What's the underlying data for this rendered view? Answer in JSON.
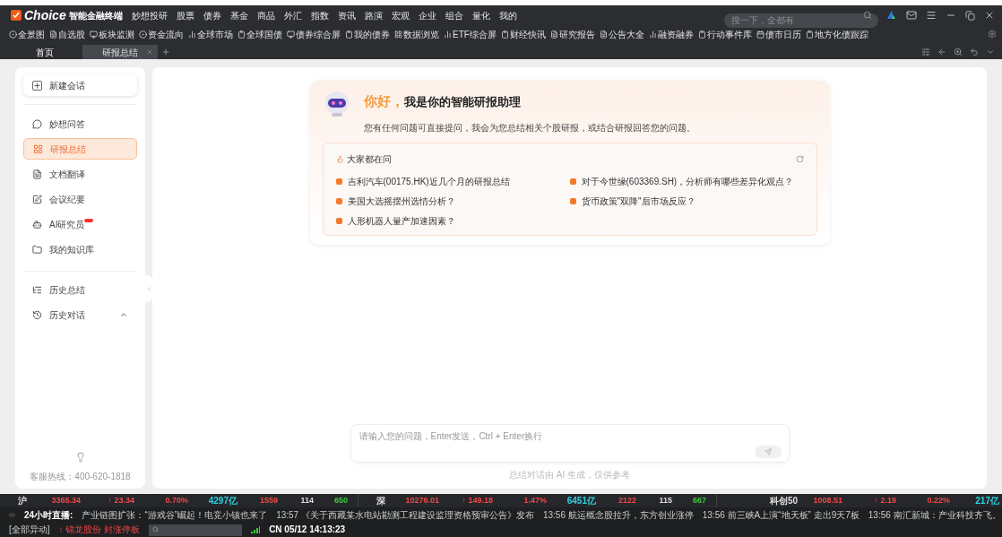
{
  "app": {
    "brand": "Choice",
    "brand_sub": "智能金融终端"
  },
  "menu": [
    "妙想投研",
    "股票",
    "债券",
    "基金",
    "商品",
    "外汇",
    "指数",
    "资讯",
    "路演",
    "宏观",
    "企业",
    "组合",
    "量化",
    "我的"
  ],
  "search": {
    "placeholder": "搜一下，全都有"
  },
  "toolbar": [
    "全景图",
    "自选股",
    "板块监测",
    "资金流向",
    "全球市场",
    "全球国债",
    "债券综合屏",
    "我的债券",
    "数据浏览",
    "ETF综合屏",
    "财经快讯",
    "研究报告",
    "公告大全",
    "融资融券",
    "行动事件库",
    "债市日历",
    "地方化债跟踪"
  ],
  "tabs": [
    {
      "label": "首页",
      "selected": false
    },
    {
      "label": "研报总结",
      "selected": true
    }
  ],
  "sidebar": {
    "new_chat": "新建会话",
    "items": [
      {
        "label": "妙想问答",
        "selected": false,
        "badge": false
      },
      {
        "label": "研报总结",
        "selected": true,
        "badge": false
      },
      {
        "label": "文档翻译",
        "selected": false,
        "badge": false
      },
      {
        "label": "会议纪要",
        "selected": false,
        "badge": false
      },
      {
        "label": "AI研究员",
        "selected": false,
        "badge": true
      },
      {
        "label": "我的知识库",
        "selected": false,
        "badge": false
      }
    ],
    "history": [
      {
        "label": "历史总结"
      },
      {
        "label": "历史对话",
        "expanded": true
      }
    ],
    "hotline": "客服热线：400-620-1818"
  },
  "assistant": {
    "greeting": "你好，",
    "title": "我是你的智能研报助理",
    "intro": "您有任何问题可直接提问，我会为您总结相关个股研报，或结合研报回答您的问题。",
    "popular_title": "大家都在问",
    "questions": [
      "吉利汽车(00175.HK)近几个月的研报总结",
      "对于今世缘(603369.SH)，分析师有哪些差异化观点？",
      "美国大选摇摆州选情分析？",
      "货币政策\"双降\"后市场反应？",
      "人形机器人量产加速因素？"
    ]
  },
  "input": {
    "placeholder": "请输入您的问题，Enter发送，Ctrl + Enter换行",
    "disclaimer": "总结对话由 AI 生成，仅供参考"
  },
  "indices": [
    {
      "name": "沪",
      "value": "3365.34",
      "change": "↑ 23.34",
      "pct": "0.70%",
      "amount": "4297亿",
      "up": "1559",
      "flat": "114",
      "down": "650"
    },
    {
      "name": "深",
      "value": "10276.01",
      "change": "↑ 149.18",
      "pct": "1.47%",
      "amount": "6451亿",
      "up": "2122",
      "flat": "115",
      "down": "667"
    },
    {
      "name": "科创50",
      "value": "1008.51",
      "change": "↑ 2.19",
      "pct": "0.22%",
      "amount": "217亿"
    }
  ],
  "ticker": {
    "label": "24小时直播:",
    "news": [
      "产业链图扩张：“游戏谷”崛起！电竞小镇也来了",
      "13:57 《关于西藏某水电站勘测工程建设监理资格预审公告》发布",
      "13:56 航运概念股拉升，东方创业涨停",
      "13:56 前三峡A上演“地天板” 走出9天7板",
      "13:56 南汇新城：产业科技齐飞。"
    ],
    "all_link": "[全部异动]",
    "alert": "↑ 锦龙股份 封涨停板",
    "clock": "CN 05/12 14:13:23"
  }
}
